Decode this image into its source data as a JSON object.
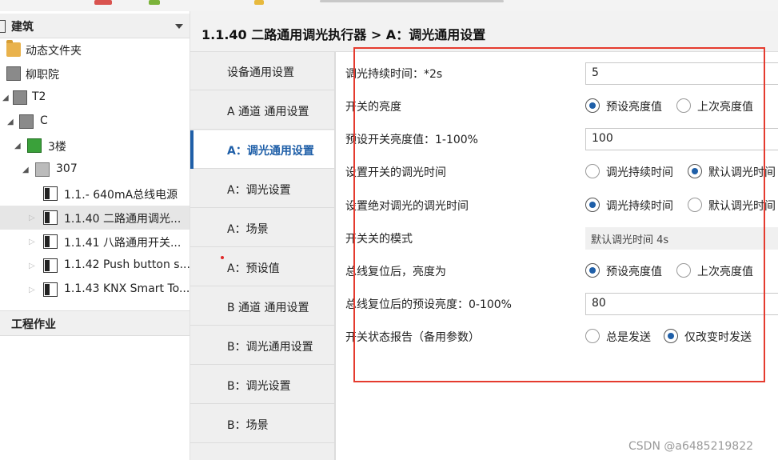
{
  "tree": {
    "title": "建筑",
    "nodes": [
      {
        "label": "动态文件夹",
        "icon": "folder-icon"
      },
      {
        "label": "柳职院",
        "icon": "building-icon"
      },
      {
        "label": "T2",
        "icon": "building-icon"
      },
      {
        "label": "C",
        "icon": "building-icon"
      },
      {
        "label": "3楼",
        "icon": "floor-icon"
      },
      {
        "label": "307",
        "icon": "room-icon"
      },
      {
        "label": "1.1.- 640mA总线电源",
        "icon": "device-icon"
      },
      {
        "label": "1.1.40 二路通用调光...",
        "icon": "device-icon"
      },
      {
        "label": "1.1.41 八路通用开关...",
        "icon": "device-icon"
      },
      {
        "label": "1.1.42 Push button s...",
        "icon": "device-icon"
      },
      {
        "label": "1.1.43 KNX Smart To...",
        "icon": "device-icon"
      }
    ],
    "project_title": "工程作业"
  },
  "header": {
    "breadcrumb": "1.1.40 二路通用调光执行器 > A：调光通用设置"
  },
  "tabs": [
    {
      "label": "设备通用设置"
    },
    {
      "label": "A 通道 通用设置"
    },
    {
      "label": "A：调光通用设置"
    },
    {
      "label": "A：调光设置"
    },
    {
      "label": "A：场景"
    },
    {
      "label": "A：预设值"
    },
    {
      "label": "B 通道 通用设置"
    },
    {
      "label": "B：调光通用设置"
    },
    {
      "label": "B：调光设置"
    },
    {
      "label": "B：场景"
    }
  ],
  "params": {
    "r1": {
      "label": "调光持续时间：*2s",
      "value": "5"
    },
    "r2": {
      "label": "开关的亮度",
      "opt1": "预设亮度值",
      "opt2": "上次亮度值"
    },
    "r3": {
      "label": "预设开关亮度值：1-100%",
      "value": "100"
    },
    "r4": {
      "label": "设置开关的调光时间",
      "opt1": "调光持续时间",
      "opt2": "默认调光时间"
    },
    "r5": {
      "label": "设置绝对调光的调光时间",
      "opt1": "调光持续时间",
      "opt2": "默认调光时间"
    },
    "r6": {
      "label": "开关关的模式",
      "value": "默认调光时间 4s"
    },
    "r7": {
      "label": "总线复位后，亮度为",
      "opt1": "预设亮度值",
      "opt2": "上次亮度值"
    },
    "r8": {
      "label": "总线复位后的预设亮度：0-100%",
      "value": "80"
    },
    "r9": {
      "label": "开关状态报告（备用参数）",
      "opt1": "总是发送",
      "opt2": "仅改变时发送"
    }
  },
  "watermark": "CSDN @a6485219822"
}
